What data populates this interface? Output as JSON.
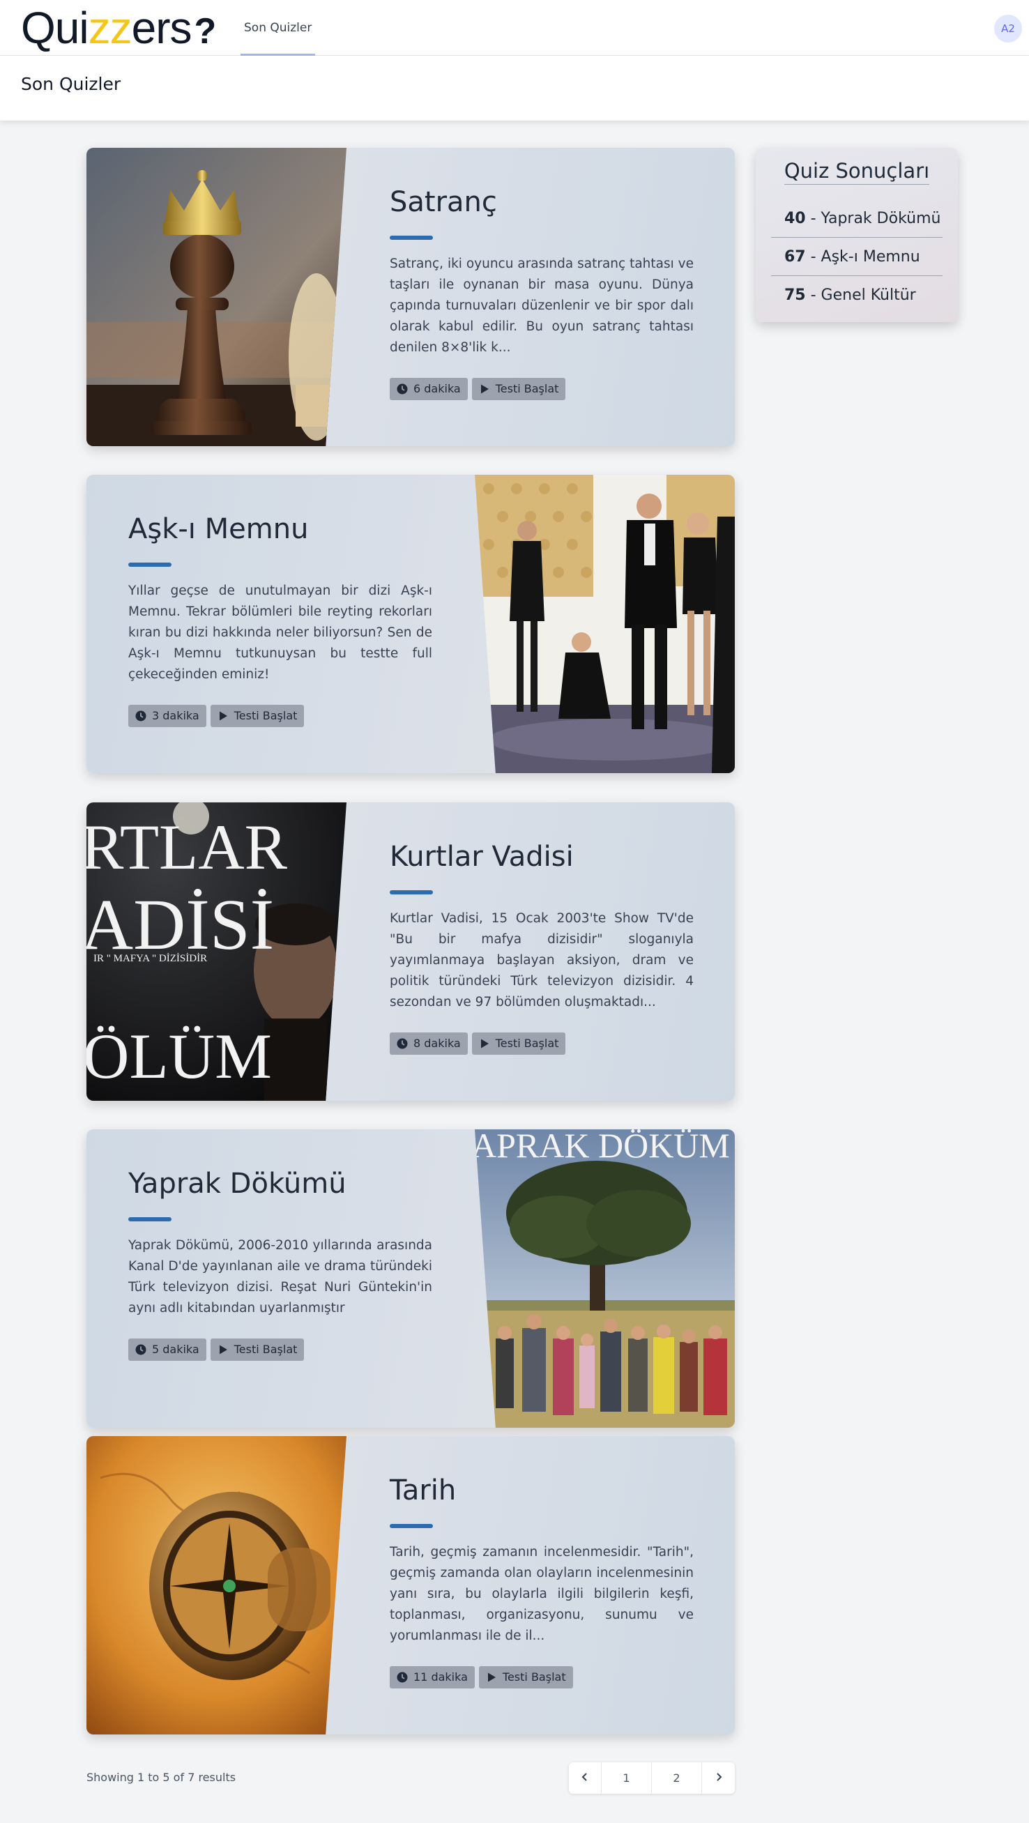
{
  "nav": {
    "logo_prefix": "Qui",
    "logo_zz": "zz",
    "logo_suffix": "ers",
    "logo_mark": "?",
    "link": "Son Quizler",
    "avatar": "A2"
  },
  "header": {
    "title": "Son Quizler"
  },
  "quizzes": [
    {
      "title": "Satranç",
      "description": "Satranç, iki oyuncu arasında satranç tahtası ve taşları ile oynanan bir masa oyunu. Dünya çapında turnuvaları düzenlenir ve bir spor dalı olarak kabul edilir. Bu oyun satranç tahtası denilen 8×8'lik k...",
      "duration": "6 dakika",
      "start": "Testi Başlat"
    },
    {
      "title": "Aşk-ı Memnu",
      "description": "Yıllar geçse de unutulmayan bir dizi Aşk-ı Memnu. Tekrar bölümleri bile reyting rekorları kıran bu dizi hakkında neler biliyorsun? Sen de Aşk-ı Memnu tutkunuysan bu testte full çekeceğinden eminiz!",
      "duration": "3 dakika",
      "start": "Testi Başlat"
    },
    {
      "title": "Kurtlar Vadisi",
      "description": "Kurtlar Vadisi, 15 Ocak 2003'te Show TV'de \"Bu bir mafya dizisidir\" sloganıyla yayımlanmaya başlayan aksiyon, dram ve politik türündeki Türk televizyon dizisidir. 4 sezondan ve 97 bölümden oluşmaktadı...",
      "duration": "8 dakika",
      "start": "Testi Başlat",
      "poster_line1": "RTLAR",
      "poster_line2": "ADİSİ",
      "poster_line3": "IR \" MAFYA \" DİZİSİDİR",
      "poster_line4": "ÖLÜM"
    },
    {
      "title": "Yaprak Dökümü",
      "description": "Yaprak Dökümü, 2006-2010 yıllarında arasında Kanal D'de yayınlanan aile ve drama türündeki Türk televizyon dizisi. Reşat Nuri Güntekin'in aynı adlı kitabından uyarlanmıştır",
      "duration": "5 dakika",
      "start": "Testi Başlat",
      "poster_line1": "APRAK DÖKÜM"
    },
    {
      "title": "Tarih",
      "description": "Tarih, geçmiş zamanın incelenmesidir. \"Tarih\", geçmiş zamanda olan olayların incelenmesinin yanı sıra, bu olaylarla ilgili bilgilerin keşfi, toplanması, organizasyonu, sunumu ve yorumlanması ile de il...",
      "duration": "11 dakika",
      "start": "Testi Başlat"
    }
  ],
  "results": {
    "title": "Quiz Sonuçları",
    "items": [
      {
        "score": "40",
        "name": " - Yaprak Dökümü"
      },
      {
        "score": "67",
        "name": " - Aşk-ı Memnu"
      },
      {
        "score": "75",
        "name": " - Genel Kültür"
      }
    ]
  },
  "pagination": {
    "summary": "Showing 1 to 5 of 7 results",
    "prev": "‹",
    "pages": [
      "1",
      "2"
    ],
    "next": "›"
  },
  "colors": {
    "accent_bar": "#2b6cb0",
    "logo_zz": "#f5c518",
    "tag_bg": "#9ca3af"
  }
}
